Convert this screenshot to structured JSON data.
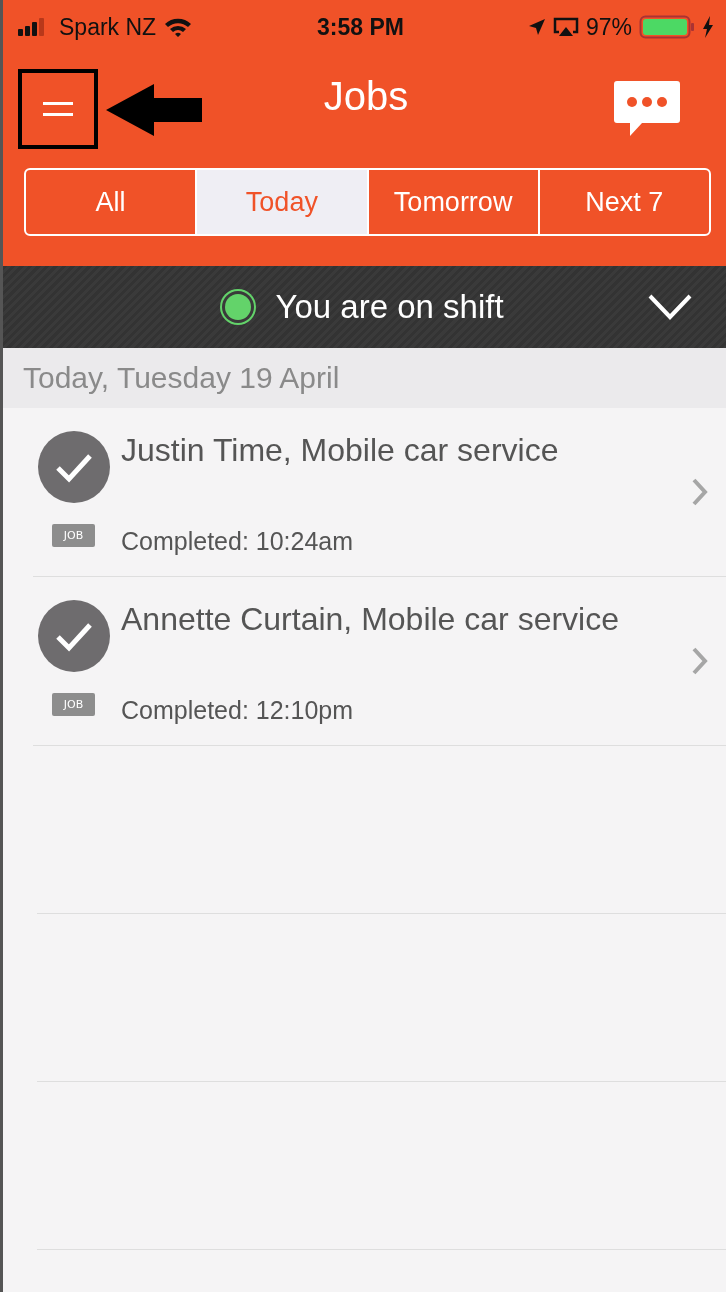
{
  "status_bar": {
    "carrier": "Spark NZ",
    "time": "3:58 PM",
    "battery": "97%"
  },
  "header": {
    "title": "Jobs"
  },
  "tabs": [
    {
      "label": "All",
      "selected": false
    },
    {
      "label": "Today",
      "selected": true
    },
    {
      "label": "Tomorrow",
      "selected": false
    },
    {
      "label": "Next 7",
      "selected": false
    }
  ],
  "shift": {
    "label": "You are on shift",
    "on_shift": true
  },
  "section": {
    "title": "Today, Tuesday 19 April"
  },
  "jobs": [
    {
      "title": "Justin Time, Mobile car service",
      "badge": "JOB",
      "status": "Completed: 10:24am",
      "completed": true
    },
    {
      "title": "Annette Curtain, Mobile car service",
      "badge": "JOB",
      "status": "Completed: 12:10pm",
      "completed": true
    }
  ]
}
